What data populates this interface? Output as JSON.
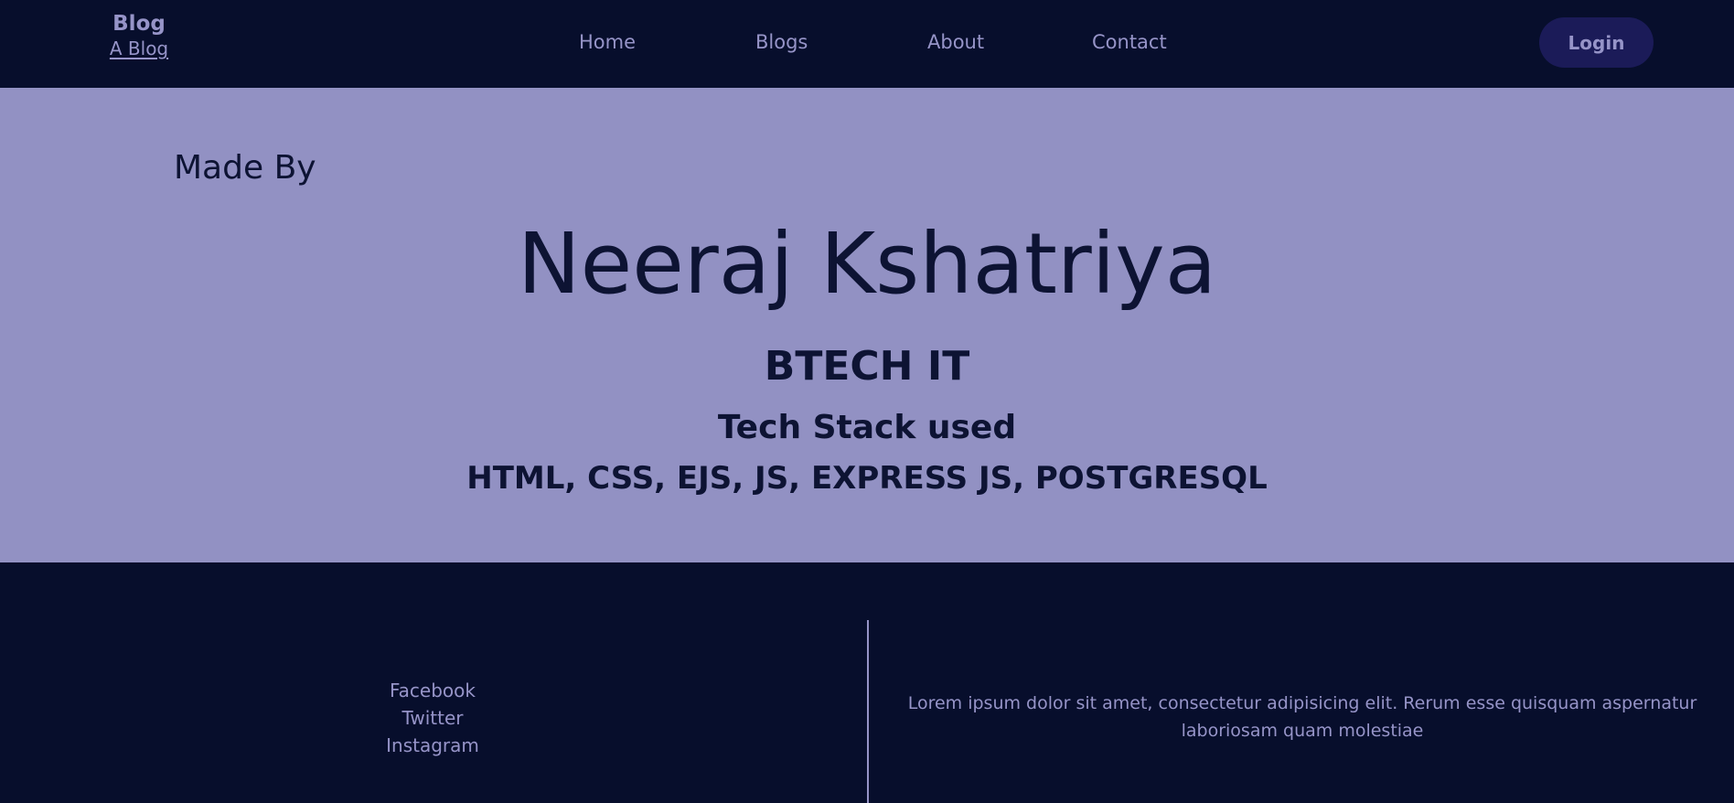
{
  "navbar": {
    "brand_title": "Blog",
    "brand_subtitle": "A Blog",
    "links": [
      {
        "label": "Home"
      },
      {
        "label": "Blogs"
      },
      {
        "label": "About"
      },
      {
        "label": "Contact"
      }
    ],
    "login_label": "Login"
  },
  "hero": {
    "made_by": "Made By",
    "name": "Neeraj Kshatriya",
    "degree": "BTECH IT",
    "stack_heading": "Tech Stack used",
    "stack_list": "HTML, CSS, EJS, JS, EXPRESS JS, POSTGRESQL"
  },
  "footer": {
    "social": [
      {
        "label": "Facebook"
      },
      {
        "label": "Twitter"
      },
      {
        "label": "Instagram"
      }
    ],
    "text": "Lorem ipsum dolor sit amet, consectetur adipisicing elit. Rerum esse quisquam aspernatur laboriosam quam molestiae"
  },
  "colors": {
    "dark_navy": "#070e2c",
    "lavender": "#9694c8",
    "hero_bg": "#9291c3",
    "button_bg": "#1b1b58",
    "hero_text": "#0d1333"
  }
}
